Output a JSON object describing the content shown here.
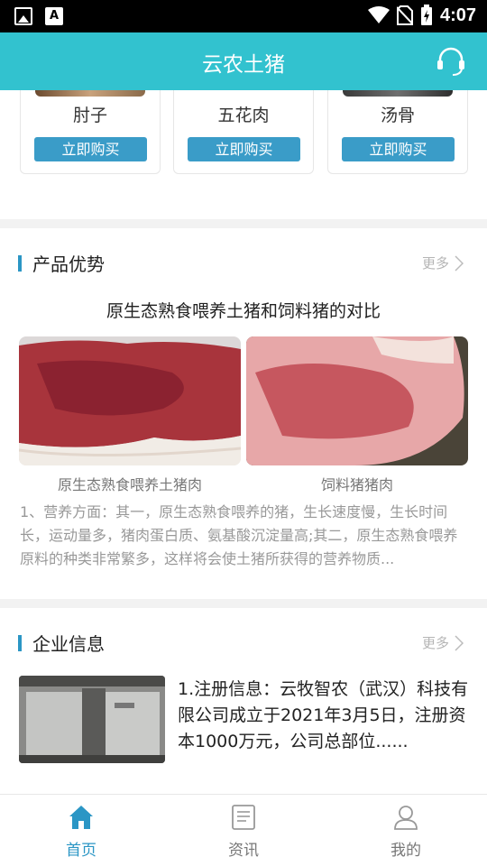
{
  "status_bar": {
    "time": "4:07",
    "icons": [
      "image-icon",
      "a-icon",
      "wifi-icon",
      "no-sim-icon",
      "battery-charging-icon"
    ]
  },
  "app_bar": {
    "title": "云农土猪",
    "support_icon": "headset-icon"
  },
  "products": [
    {
      "name": "肘子",
      "buy_label": "立即购买"
    },
    {
      "name": "五花肉",
      "buy_label": "立即购买"
    },
    {
      "name": "汤骨",
      "buy_label": "立即购买"
    }
  ],
  "advantage": {
    "title": "产品优势",
    "more": "更多",
    "compare_title": "原生态熟食喂养土猪和饲料猪的对比",
    "left_caption": "原生态熟食喂养土猪肉",
    "right_caption": "饲料猪猪肉",
    "description": "1、营养方面：其一，原生态熟食喂养的猪，生长速度慢，生长时间长，运动量多，猪肉蛋白质、氨基酸沉淀量高;其二，原生态熟食喂养原料的种类非常繁多，这样将会使土猪所获得的营养物质..."
  },
  "company": {
    "title": "企业信息",
    "more": "更多",
    "text": "1.注册信息：云牧智农（武汉）科技有限公司成立于2021年3月5日，注册资本1000万元，公司总部位......"
  },
  "bottom_nav": [
    {
      "label": "首页",
      "icon": "home-icon",
      "active": true
    },
    {
      "label": "资讯",
      "icon": "news-icon",
      "active": false
    },
    {
      "label": "我的",
      "icon": "user-icon",
      "active": false
    }
  ],
  "colors": {
    "accent": "#32c2cf",
    "button": "#3a9cc8",
    "active_nav": "#2b96c5"
  }
}
